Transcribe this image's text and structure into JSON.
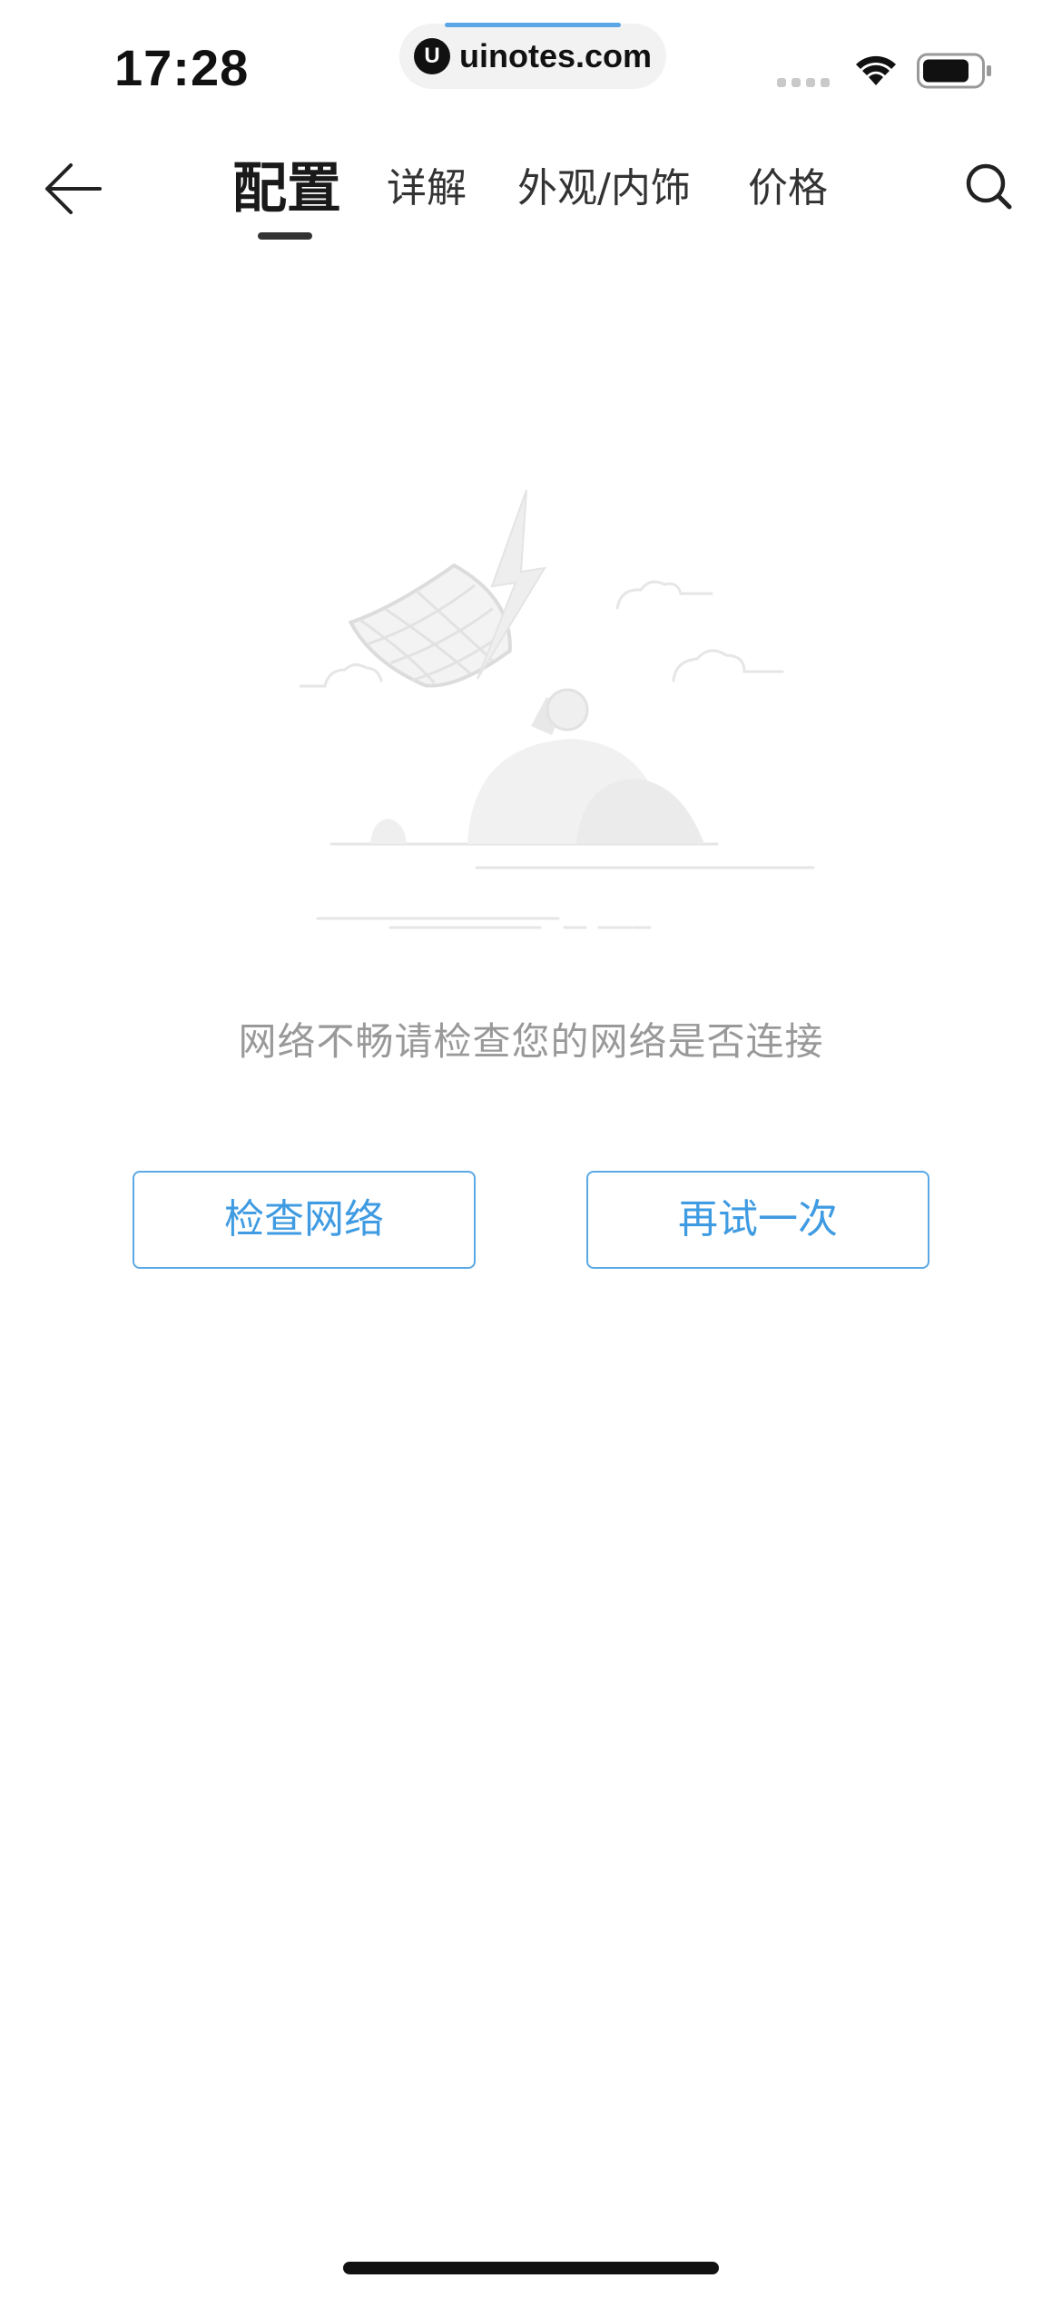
{
  "status_bar": {
    "time": "17:28",
    "url": "uinotes.com",
    "logo_letter": "U"
  },
  "nav": {
    "back_icon": "back-arrow-icon",
    "tabs": [
      {
        "label": "配置",
        "active": true
      },
      {
        "label": "详解",
        "active": false
      },
      {
        "label": "外观/内饰",
        "active": false
      },
      {
        "label": "价格",
        "active": false
      }
    ],
    "search_icon": "search-icon"
  },
  "empty_state": {
    "illustration": "satellite-dish-icon",
    "message": "网络不畅请检查您的网络是否连接"
  },
  "actions": {
    "check_network": "检查网络",
    "retry": "再试一次"
  },
  "colors": {
    "accent": "#3f9be2",
    "button_border": "#5aa9e6",
    "message_text": "#999999",
    "illustration_gray": "#e3e3e3"
  }
}
